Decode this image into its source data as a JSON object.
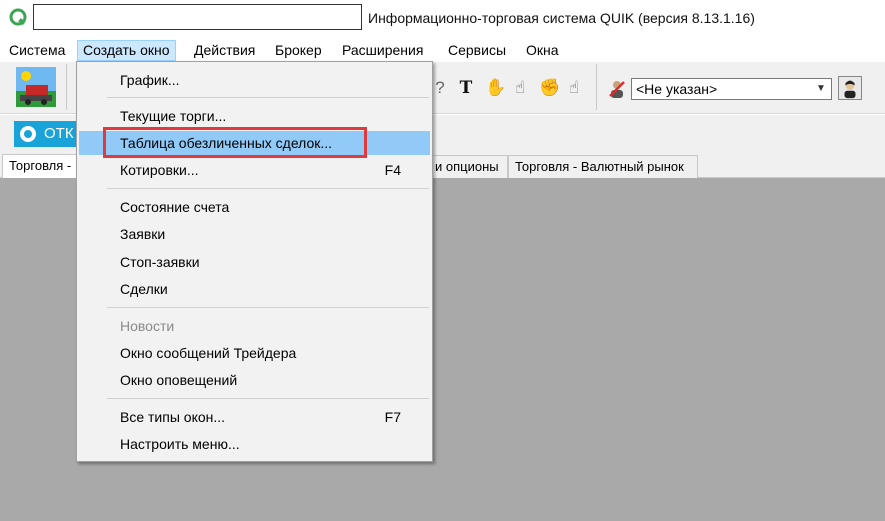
{
  "window": {
    "title": "Информационно-торговая система QUIK (версия 8.13.1.16)",
    "accent_color": "#e0393e"
  },
  "menubar": {
    "items": [
      "Система",
      "Создать окно",
      "Действия",
      "Брокер",
      "Расширения",
      "Сервисы",
      "Окна"
    ],
    "active_index": 1
  },
  "toolbar": {
    "account_combo_value": "<Не указан>"
  },
  "open_button": {
    "label": "ОТК"
  },
  "tabs": {
    "items": [
      "Торговля -",
      "и опционы",
      "Торговля - Валютный рынок"
    ]
  },
  "dropdown": {
    "items": [
      {
        "label": "График...",
        "shortcut": ""
      },
      {
        "label": "Текущие торги...",
        "shortcut": ""
      },
      {
        "label": "Таблица обезличенных сделок...",
        "shortcut": ""
      },
      {
        "label": "Котировки...",
        "shortcut": "F4"
      },
      {
        "label": "Состояние счета",
        "shortcut": ""
      },
      {
        "label": "Заявки",
        "shortcut": ""
      },
      {
        "label": "Стоп-заявки",
        "shortcut": ""
      },
      {
        "label": "Сделки",
        "shortcut": ""
      },
      {
        "label": "Новости",
        "shortcut": ""
      },
      {
        "label": "Окно сообщений Трейдера",
        "shortcut": ""
      },
      {
        "label": "Окно оповещений",
        "shortcut": ""
      },
      {
        "label": "Все типы окон...",
        "shortcut": "F7"
      },
      {
        "label": "Настроить меню...",
        "shortcut": ""
      }
    ]
  }
}
